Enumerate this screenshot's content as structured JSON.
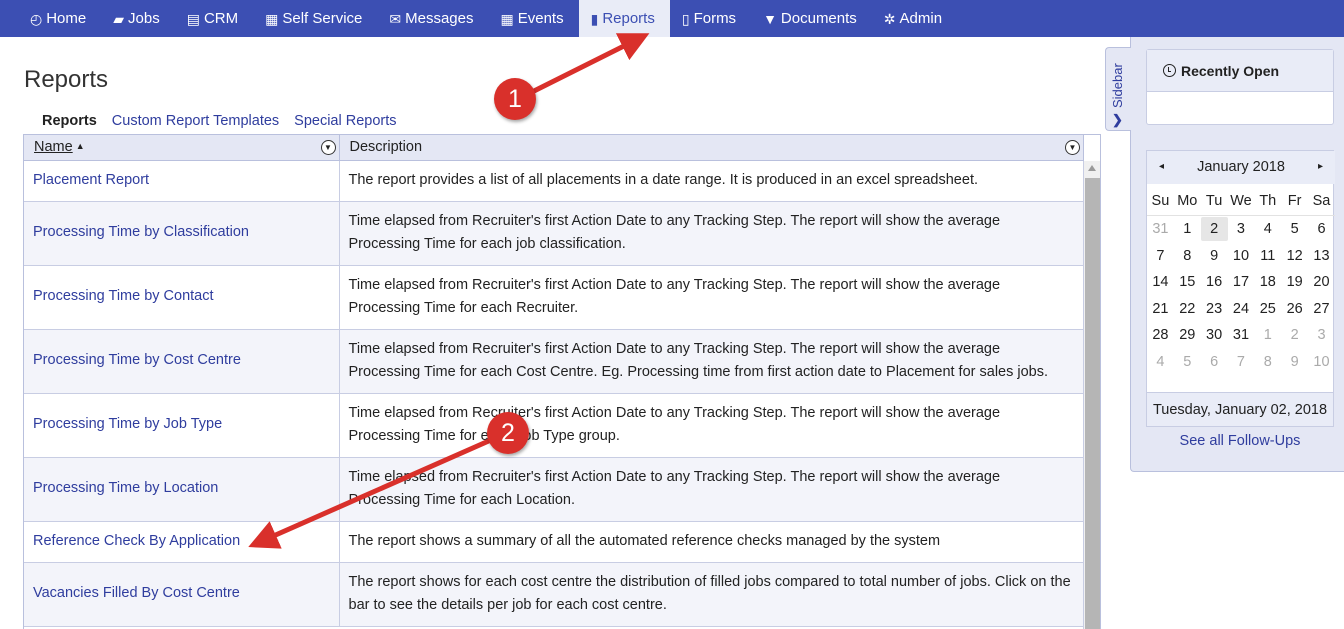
{
  "nav": [
    {
      "label": "Home",
      "icon": "dashboard-icon",
      "glyph": "◴"
    },
    {
      "label": "Jobs",
      "icon": "folder-icon",
      "glyph": "▰"
    },
    {
      "label": "CRM",
      "icon": "briefcase-icon",
      "glyph": "▤"
    },
    {
      "label": "Self Service",
      "icon": "server-icon",
      "glyph": "▦"
    },
    {
      "label": "Messages",
      "icon": "envelope-icon",
      "glyph": "✉"
    },
    {
      "label": "Events",
      "icon": "calendar-icon",
      "glyph": "▦"
    },
    {
      "label": "Reports",
      "icon": "book-icon",
      "glyph": "▮"
    },
    {
      "label": "Forms",
      "icon": "file-icon",
      "glyph": "▯"
    },
    {
      "label": "Documents",
      "icon": "funnel-icon",
      "glyph": "▼"
    },
    {
      "label": "Admin",
      "icon": "gear-icon",
      "glyph": "✲"
    }
  ],
  "active_nav": "Reports",
  "page_title": "Reports",
  "subtabs": [
    "Reports",
    "Custom Report Templates",
    "Special Reports"
  ],
  "table": {
    "headers": {
      "name": "Name",
      "description": "Description"
    },
    "sort_indicator": "▲",
    "rows": [
      {
        "name": "Placement Report",
        "description": "The report provides a list of all placements in a date range. It is produced in an excel spreadsheet."
      },
      {
        "name": "Processing Time by Classification",
        "description": "Time elapsed from Recruiter's first Action Date to any Tracking Step. The report will show the average Processing Time for each job classification."
      },
      {
        "name": "Processing Time by Contact",
        "description": "Time elapsed from Recruiter's first Action Date to any Tracking Step. The report will show the average Processing Time for each Recruiter."
      },
      {
        "name": "Processing Time by Cost Centre",
        "description": "Time elapsed from Recruiter's first Action Date to any Tracking Step. The report will show the average Processing Time for each Cost Centre. Eg. Processing time from first action date to Placement for sales jobs."
      },
      {
        "name": "Processing Time by Job Type",
        "description": "Time elapsed from Recruiter's first Action Date to any Tracking Step. The report will show the average Processing Time for each Job Type group."
      },
      {
        "name": "Processing Time by Location",
        "description": "Time elapsed from Recruiter's first Action Date to any Tracking Step. The report will show the average Processing Time for each Location."
      },
      {
        "name": "Reference Check By Application",
        "description": "The report shows a summary of all the automated reference checks managed by the system"
      },
      {
        "name": "Vacancies Filled By Cost Centre",
        "description": "The report shows for each cost centre the distribution of filled jobs compared to total number of jobs. Click on the bar to see the details per job for each cost centre."
      }
    ]
  },
  "sidebar": {
    "toggle_label": "Sidebar",
    "recently_open_title": "Recently Open",
    "calendar": {
      "month": "January 2018",
      "prev": "◂",
      "next": "▸",
      "weekdays": [
        "Su",
        "Mo",
        "Tu",
        "We",
        "Th",
        "Fr",
        "Sa"
      ],
      "weeks": [
        [
          "31",
          "1",
          "2",
          "3",
          "4",
          "5",
          "6"
        ],
        [
          "7",
          "8",
          "9",
          "10",
          "11",
          "12",
          "13"
        ],
        [
          "14",
          "15",
          "16",
          "17",
          "18",
          "19",
          "20"
        ],
        [
          "21",
          "22",
          "23",
          "24",
          "25",
          "26",
          "27"
        ],
        [
          "28",
          "29",
          "30",
          "31",
          "1",
          "2",
          "3"
        ],
        [
          "4",
          "5",
          "6",
          "7",
          "8",
          "9",
          "10"
        ]
      ],
      "selected_date": "Tuesday, January 02, 2018"
    },
    "followups_link": "See all Follow-Ups"
  },
  "annotations": [
    "1",
    "2"
  ],
  "colors": {
    "nav_bg": "#3c4fb3",
    "link": "#2f3d9e",
    "annotation": "#d9302b"
  }
}
